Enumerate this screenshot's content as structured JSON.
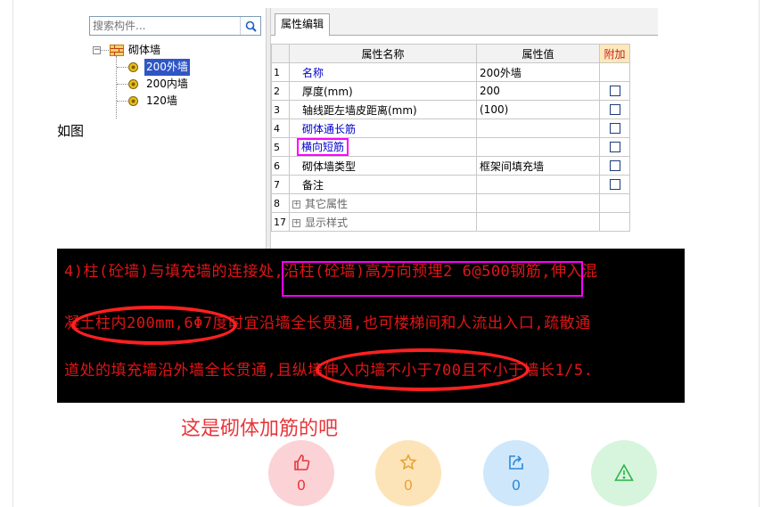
{
  "search": {
    "placeholder": "搜索构件..."
  },
  "tree": {
    "root": "砌体墙",
    "items": [
      "200外墙",
      "200内墙",
      "120墙"
    ],
    "selected_index": 0
  },
  "tab": "属性编辑",
  "table": {
    "headers": {
      "name": "属性名称",
      "value": "属性值",
      "add": "附加"
    },
    "rows": [
      {
        "num": "1",
        "name": "名称",
        "value": "200外墙",
        "color": "blue",
        "check": false
      },
      {
        "num": "2",
        "name": "厚度(mm)",
        "value": "200",
        "color": "black",
        "check": true
      },
      {
        "num": "3",
        "name": "轴线距左墙皮距离(mm)",
        "value": "(100)",
        "color": "black",
        "check": true
      },
      {
        "num": "4",
        "name": "砌体通长筋",
        "value": "",
        "color": "blue",
        "check": true
      },
      {
        "num": "5",
        "name": "横向短筋",
        "value": "",
        "color": "blue",
        "check": true,
        "highlight": true
      },
      {
        "num": "6",
        "name": "砌体墙类型",
        "value": "框架间填充墙",
        "color": "black",
        "check": true
      },
      {
        "num": "7",
        "name": "备注",
        "value": "",
        "color": "black",
        "check": true
      },
      {
        "num": "8",
        "name": "其它属性",
        "value": "",
        "color": "gray",
        "group": true
      },
      {
        "num": "17",
        "name": "显示样式",
        "value": "",
        "color": "gray",
        "group": true
      }
    ]
  },
  "caption": "如图",
  "cad_text": {
    "line1": "4)柱(砼墙)与填充墙的连接处,沿柱(砼墙)高方向预埋2 6@500钢筋,伸入混",
    "line2": "凝土柱内200mm,6Φ7度时宜沿墙全长贯通,也可楼梯间和人流出入口,疏散通",
    "line3": "道处的填充墙沿外墙全长贯通,且纵墙伸入内墙不小于700且不小于墙长1/5."
  },
  "note": "这是砌体加筋的吧",
  "actions": [
    {
      "name": "like",
      "count": "0",
      "bg": "#fbd3d6",
      "color": "#e8363a"
    },
    {
      "name": "favorite",
      "count": "0",
      "bg": "#fde4b8",
      "color": "#e8a23a"
    },
    {
      "name": "share",
      "count": "0",
      "bg": "#cfe7fb",
      "color": "#2b8ad8"
    },
    {
      "name": "report",
      "count": "",
      "bg": "#d6f5dc",
      "color": "#2fb34a"
    }
  ]
}
